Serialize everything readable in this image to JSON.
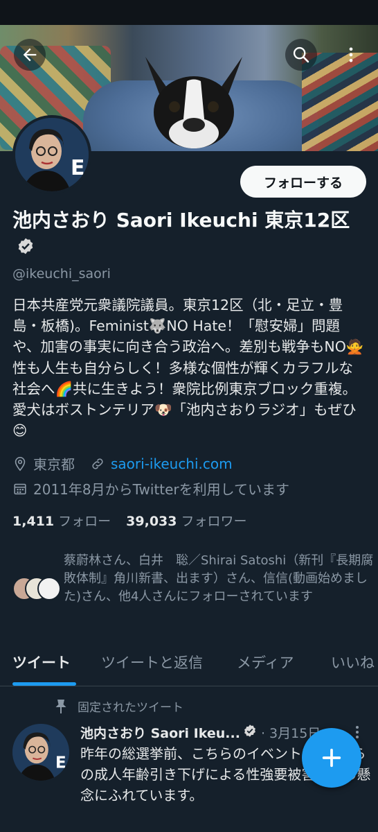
{
  "header": {
    "back_icon": "arrow-left-icon",
    "search_icon": "search-icon",
    "more_icon": "more-vertical-icon"
  },
  "profile": {
    "follow_label": "フォローする",
    "name": "池内さおり Saori Ikeuchi 東京12区",
    "handle": "@ikeuchi_saori",
    "bio": "日本共産党元衆議院議員。東京12区（北・足立・豊島・板橋)。Feminist🐺NO Hate！「慰安婦」問題や、加害の事実に向き合う政治へ。差別も戦争もNO🙅性も人生も自分らしく！多様な個性が輝くカラフルな社会へ🌈共に生きよう！衆院比例東京ブロック重複。愛犬はボストンテリア🐶「池内さおりラジオ」もぜひ😊",
    "location": "東京都",
    "website": "saori-ikeuchi.com",
    "joined": "2011年8月からTwitterを利用しています",
    "following_count": "1,411",
    "following_label": "フォロー",
    "followers_count": "39,033",
    "followers_label": "フォロワー",
    "known_followers": "蔡蔚林さん、白井　聡／Shirai Satoshi（新刊『長期腐敗体制』角川新書、出ます）さん、信信(動画始めました)さん、他4人さんにフォローされています"
  },
  "tabs": [
    {
      "label": "ツイート",
      "active": true
    },
    {
      "label": "ツイートと返信",
      "active": false
    },
    {
      "label": "メディア",
      "active": false
    },
    {
      "label": "いいね",
      "active": false
    }
  ],
  "pinned_tweet": {
    "pinned_label": "固定されたツイート",
    "author": "池内さおり Saori Ikeu...",
    "date": "· 3月15日",
    "text": "昨年の総選挙前、こちらのイベントで4月からの成人年齢引き下げによる性強要被害拡大の懸念にふれています。"
  },
  "colors": {
    "background": "#15202b",
    "accent": "#1d9bf0",
    "muted": "#8b98a5"
  }
}
